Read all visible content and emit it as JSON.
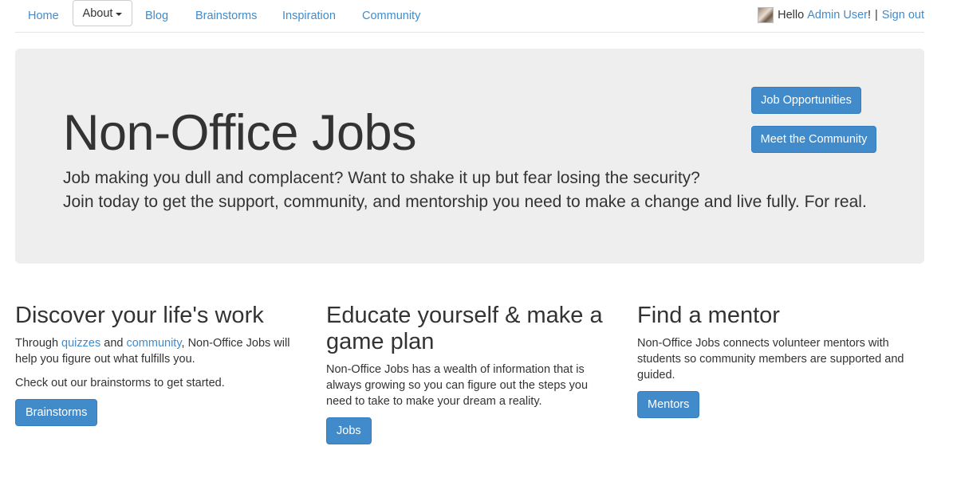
{
  "nav": {
    "home": "Home",
    "about": "About",
    "blog": "Blog",
    "brainstorms": "Brainstorms",
    "inspiration": "Inspiration",
    "community": "Community",
    "hello": "Hello",
    "user_name": "Admin User",
    "exclaim": "!",
    "separator": "|",
    "sign_out": "Sign out"
  },
  "hero": {
    "title": "Non-Office Jobs",
    "line1": "Job making you dull and complacent? Want to shake it up but fear losing the security?",
    "line2": "Join today to get the support, community, and mentorship you need to make a change and live fully. For real.",
    "btn_jobs": "Job Opportunities",
    "btn_community": "Meet the Community"
  },
  "columns": {
    "discover": {
      "title": "Discover your life's work",
      "p1_pre": "Through",
      "link_quizzes": "quizzes",
      "p1_and": "and",
      "link_community": "community",
      "p1_post": ", Non-Office Jobs will help you figure out what fulfills you.",
      "p2": "Check out our brainstorms to get started.",
      "button": "Brainstorms"
    },
    "educate": {
      "title": "Educate yourself & make a game plan",
      "p1": "Non-Office Jobs has a wealth of information that is always growing so you can figure out the steps you need to take to make your dream a reality.",
      "button": "Jobs"
    },
    "mentor": {
      "title": "Find a mentor",
      "p1": "Non-Office Jobs connects volunteer mentors with students so community members are supported and guided.",
      "button": "Mentors"
    }
  },
  "colors": {
    "link": "#428bca",
    "button": "#428bca",
    "jumbotron_bg": "#eeeeee",
    "text": "#333333"
  }
}
